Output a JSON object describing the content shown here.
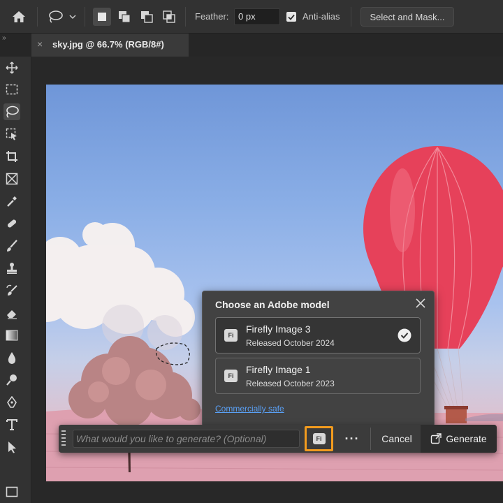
{
  "options_bar": {
    "tool_icon": "lasso-icon",
    "selection_modes": [
      "new-selection-icon",
      "add-to-selection-icon",
      "subtract-from-selection-icon",
      "intersect-selection-icon"
    ],
    "feather_label": "Feather:",
    "feather_value": "0 px",
    "antialias_label": "Anti-alias",
    "antialias_checked": true,
    "select_and_mask_label": "Select and Mask..."
  },
  "tab": {
    "close_glyph": "×",
    "title": "sky.jpg @ 66.7% (RGB/8#)"
  },
  "toolbar": {
    "tools": [
      "move-icon",
      "marquee-icon",
      "lasso-icon",
      "object-selection-icon",
      "crop-icon",
      "frame-icon",
      "eyedropper-icon",
      "healing-brush-icon",
      "brush-icon",
      "clone-stamp-icon",
      "history-brush-icon",
      "eraser-icon",
      "gradient-icon",
      "blur-icon",
      "dodge-icon",
      "pen-icon",
      "type-icon",
      "path-selection-icon",
      "rectangle-icon"
    ],
    "active": "lasso-icon"
  },
  "model_popup": {
    "title": "Choose an Adobe model",
    "models": [
      {
        "name": "Firefly Image 3",
        "date": "Released October 2024",
        "selected": true
      },
      {
        "name": "Firefly Image 1",
        "date": "Released October 2023",
        "selected": false
      }
    ],
    "badge": "Fi",
    "commercially_safe_link": "Commercially safe"
  },
  "taskbar": {
    "prompt_placeholder": "What would you like to generate? (Optional)",
    "model_badge": "Fi",
    "more_label": "···",
    "cancel_label": "Cancel",
    "generate_label": "Generate"
  },
  "colors": {
    "highlight": "#f29b1e",
    "link": "#5aa0f5",
    "balloon": "#e6415a"
  }
}
